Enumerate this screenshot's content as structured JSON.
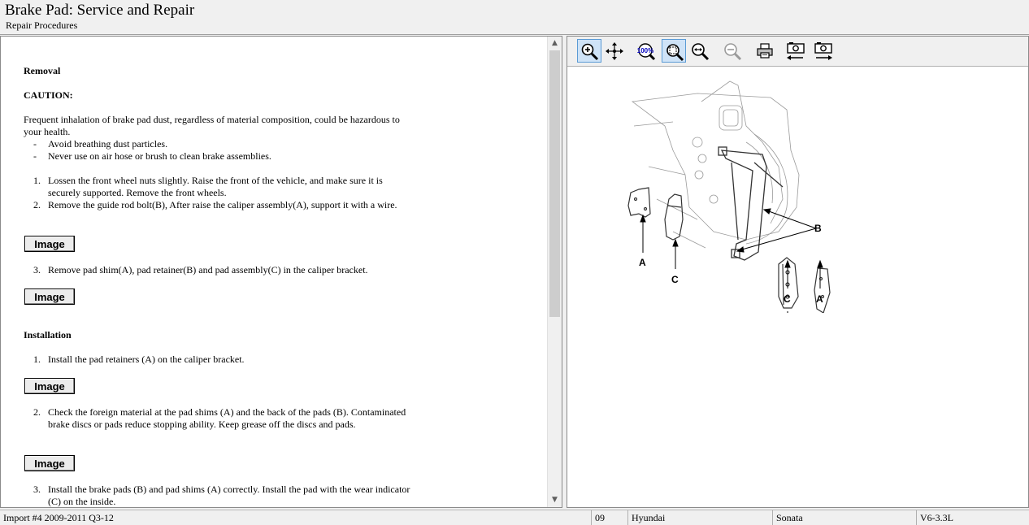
{
  "header": {
    "title": "Brake Pad:  Service and Repair",
    "subtitle": "Repair Procedures"
  },
  "content": {
    "removal_heading": "Removal",
    "caution_heading": "CAUTION:",
    "caution_text": "Frequent inhalation of brake pad dust, regardless of material composition, could be hazardous to your health.",
    "caution_items": [
      {
        "marker": "-",
        "text": "Avoid breathing dust particles."
      },
      {
        "marker": "-",
        "text": "Never use on air hose or brush to clean brake assemblies."
      }
    ],
    "removal_steps": [
      {
        "marker": "1.",
        "text": "Lossen the front wheel nuts slightly. Raise the front of the vehicle, and make sure it is securely supported. Remove the front wheels."
      },
      {
        "marker": "2.",
        "text": "Remove the guide rod bolt(B), After raise the caliper assembly(A), support it with a wire."
      },
      {
        "marker": "3.",
        "text": "Remove pad shim(A), pad retainer(B) and pad assembly(C) in the caliper bracket."
      }
    ],
    "installation_heading": "Installation",
    "installation_steps": [
      {
        "marker": "1.",
        "text": "Install the pad retainers (A) on the caliper bracket."
      },
      {
        "marker": "2.",
        "text": "Check the foreign material at the pad shims (A) and the back of the pads (B). Contaminated brake discs or pads reduce stopping ability. Keep grease off the discs and pads."
      },
      {
        "marker": "3.",
        "text": "Install the brake pads (B) and pad shims (A) correctly. Install the pad with the wear indicator (C) on the inside."
      }
    ],
    "image_button_label": "Image"
  },
  "toolbar": {
    "buttons": [
      {
        "icon": "zoom-in-icon",
        "active": true
      },
      {
        "icon": "pan-icon",
        "active": false
      },
      {
        "icon": "zoom-100-icon",
        "active": false
      },
      {
        "icon": "zoom-fit-icon",
        "active": true
      },
      {
        "icon": "zoom-width-icon",
        "active": false
      },
      {
        "icon": "zoom-out-icon",
        "active": false
      },
      {
        "icon": "print-icon",
        "active": false
      },
      {
        "icon": "previous-image-icon",
        "active": false
      },
      {
        "icon": "next-image-icon",
        "active": false
      }
    ],
    "zoom_100_label": "100%"
  },
  "figure": {
    "callouts": [
      "A",
      "C",
      "B",
      "C",
      "A"
    ]
  },
  "status": {
    "import": "Import #4 2009-2011 Q3-12",
    "year": "09",
    "make": "Hyundai",
    "model": "Sonata",
    "engine": "V6-3.3L"
  }
}
